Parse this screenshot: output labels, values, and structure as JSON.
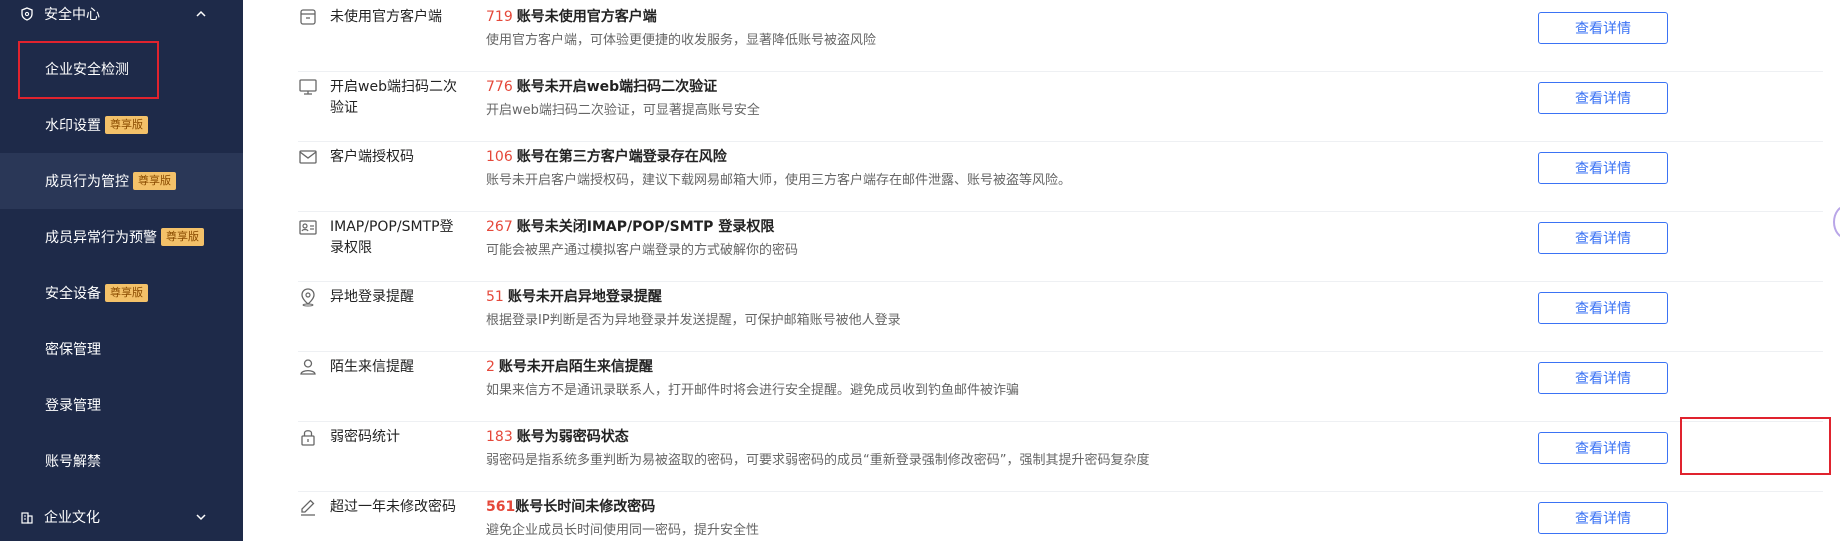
{
  "sidebar": {
    "section_security": "安全中心",
    "section_culture": "企业文化",
    "items": [
      {
        "label": "企业安全检测",
        "badge": ""
      },
      {
        "label": "水印设置",
        "badge": "尊享版"
      },
      {
        "label": "成员行为管控",
        "badge": "尊享版"
      },
      {
        "label": "成员异常行为预警",
        "badge": "尊享版"
      },
      {
        "label": "安全设备",
        "badge": "尊享版"
      },
      {
        "label": "密保管理",
        "badge": ""
      },
      {
        "label": "登录管理",
        "badge": ""
      },
      {
        "label": "账号解禁",
        "badge": ""
      }
    ]
  },
  "rows": [
    {
      "icon": "client-icon",
      "name": "未使用官方客户端",
      "count": "719",
      "title": "账号未使用官方客户端",
      "desc": "使用官方客户端，可体验更便捷的收发服务，显著降低账号被盗风险",
      "button": "查看详情"
    },
    {
      "icon": "monitor-icon",
      "name": "开启web端扫码二次验证",
      "count": "776",
      "title": "账号未开启web端扫码二次验证",
      "desc": "开启web端扫码二次验证，可显著提高账号安全",
      "button": "查看详情"
    },
    {
      "icon": "mail-icon",
      "name": "客户端授权码",
      "count": "106",
      "title": "账号在第三方客户端登录存在风险",
      "desc": "账号未开启客户端授权码，建议下载网易邮箱大师，使用三方客户端存在邮件泄露、账号被盗等风险。",
      "button": "查看详情"
    },
    {
      "icon": "id-card-icon",
      "name": "IMAP/POP/SMTP登录权限",
      "count": "267",
      "title": "账号未关闭IMAP/POP/SMTP 登录权限",
      "desc": "可能会被黑产通过模拟客户端登录的方式破解你的密码",
      "button": "查看详情"
    },
    {
      "icon": "location-icon",
      "name": "异地登录提醒",
      "count": "51",
      "title": "账号未开启异地登录提醒",
      "desc": "根据登录IP判断是否为异地登录并发送提醒，可保护邮箱账号被他人登录",
      "button": "查看详情"
    },
    {
      "icon": "user-icon",
      "name": "陌生来信提醒",
      "count": "2",
      "title": "账号未开启陌生来信提醒",
      "desc": "如果来信方不是通讯录联系人，打开邮件时将会进行安全提醒。避免成员收到钓鱼邮件被诈骗",
      "button": "查看详情"
    },
    {
      "icon": "lock-icon",
      "name": "弱密码统计",
      "count": "183",
      "title": "账号为弱密码状态",
      "desc": "弱密码是指系统多重判断为易被盗取的密码，可要求弱密码的成员“重新登录强制修改密码”，强制其提升密码复杂度",
      "button": "查看详情"
    },
    {
      "icon": "pencil-icon",
      "name": "超过一年未修改密码",
      "count": "561",
      "title": "账号长时间未修改密码",
      "desc": "避免企业成员长时间使用同一密码，提升安全性",
      "button": "查看详情"
    }
  ],
  "colors": {
    "sidebar_bg": "#1e2a49",
    "accent": "#3b73f4",
    "count": "#e5483a",
    "highlight": "#e0232e",
    "badge": "#f3c169"
  }
}
